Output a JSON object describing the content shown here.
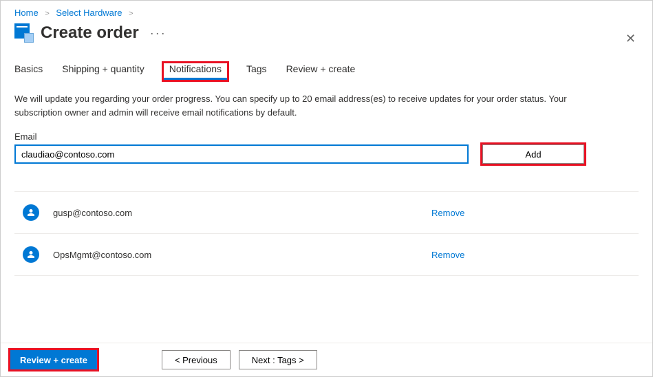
{
  "breadcrumb": {
    "home": "Home",
    "select_hardware": "Select Hardware"
  },
  "header": {
    "title": "Create order"
  },
  "tabs": {
    "basics": "Basics",
    "shipping": "Shipping + quantity",
    "notifications": "Notifications",
    "tags": "Tags",
    "review": "Review + create"
  },
  "body": {
    "description": "We will update you regarding your order progress. You can specify up to 20 email address(es) to receive updates for your order status. Your subscription owner and admin will receive email notifications by default.",
    "email_label": "Email",
    "email_value": "claudiao@contoso.com",
    "add_button": "Add",
    "remove_label": "Remove",
    "emails": [
      "gusp@contoso.com",
      "OpsMgmt@contoso.com"
    ]
  },
  "footer": {
    "review_create": "Review + create",
    "previous": "< Previous",
    "next": "Next : Tags >"
  }
}
